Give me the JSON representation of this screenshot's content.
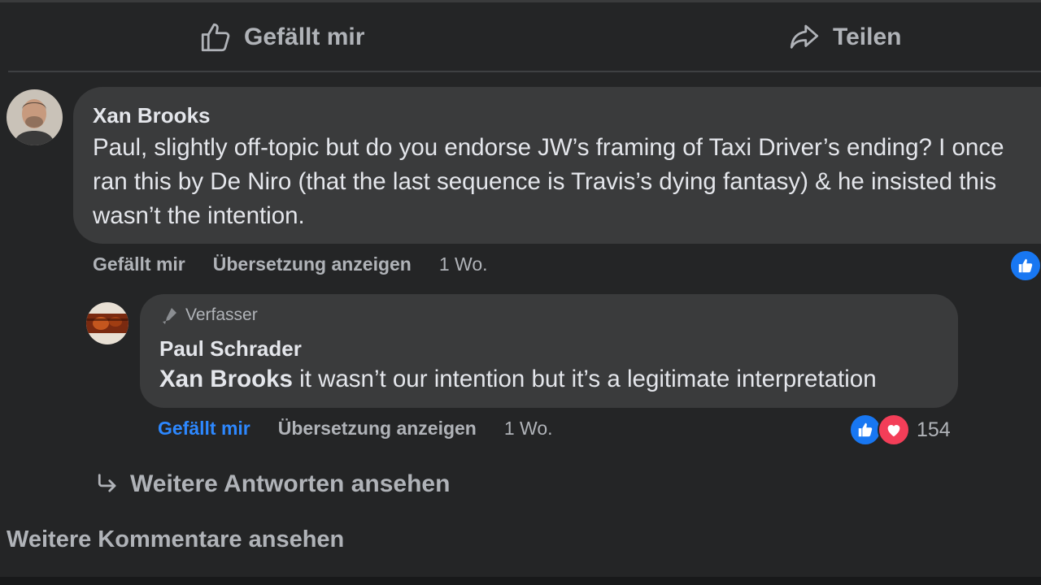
{
  "actions": {
    "like_label": "Gefällt mir",
    "share_label": "Teilen"
  },
  "comment": {
    "author": "Xan Brooks",
    "text": "Paul, slightly off-topic but do you endorse JW’s framing of Taxi Driver’s ending? I once ran this by De Niro (that the last sequence is Travis’s dying fantasy) & he insisted this wasn’t the intention.",
    "like_label": "Gefällt mir",
    "translate_label": "Übersetzung anzeigen",
    "time": "1 Wo."
  },
  "reply": {
    "badge": "Verfasser",
    "author": "Paul Schrader",
    "mention": "Xan Brooks",
    "text": " it wasn’t our intention but it’s a legitimate interpretation",
    "like_label": "Gefällt mir",
    "translate_label": "Übersetzung anzeigen",
    "time": "1 Wo.",
    "reaction_count": "154"
  },
  "more_replies_label": "Weitere Antworten ansehen",
  "more_comments_label": "Weitere Kommentare ansehen",
  "colors": {
    "background": "#242526",
    "bubble": "#3a3b3c",
    "accent_blue": "#2d88ff",
    "heart_red": "#f33e58"
  },
  "icons": [
    "thumbs-up-icon",
    "share-icon",
    "pen-icon",
    "like-reaction-icon",
    "heart-reaction-icon",
    "reply-arrow-icon"
  ]
}
